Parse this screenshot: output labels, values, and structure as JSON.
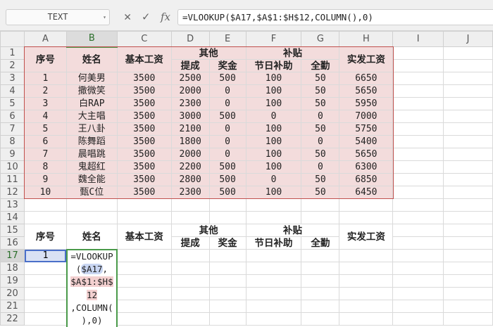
{
  "toolbar": {
    "name_box": "TEXT",
    "cancel_icon": "✕",
    "confirm_icon": "✓",
    "fx_label": "fx",
    "formula": "=VLOOKUP($A17,$A$1:$H$12,COLUMN(),0)"
  },
  "columns": [
    "A",
    "B",
    "C",
    "D",
    "E",
    "F",
    "G",
    "H",
    "I",
    "J"
  ],
  "header": {
    "seq": "序号",
    "name": "姓名",
    "base": "基本工资",
    "other": "其他",
    "commission": "提成",
    "bonus": "奖金",
    "subsidy": "补贴",
    "holiday": "节日补助",
    "attendance": "全勤",
    "net": "实发工资"
  },
  "rows": [
    [
      "1",
      "何美男",
      "3500",
      "2500",
      "500",
      "100",
      "50",
      "6650"
    ],
    [
      "2",
      "撒微笑",
      "3500",
      "2000",
      "0",
      "100",
      "50",
      "5650"
    ],
    [
      "3",
      "白RAP",
      "3500",
      "2300",
      "0",
      "100",
      "50",
      "5950"
    ],
    [
      "4",
      "大主唱",
      "3500",
      "3000",
      "500",
      "0",
      "0",
      "7000"
    ],
    [
      "5",
      "王八卦",
      "3500",
      "2100",
      "0",
      "100",
      "50",
      "5750"
    ],
    [
      "6",
      "陈舞蹈",
      "3500",
      "1800",
      "0",
      "100",
      "0",
      "5400"
    ],
    [
      "7",
      "晨唱跳",
      "3500",
      "2000",
      "0",
      "100",
      "50",
      "5650"
    ],
    [
      "8",
      "鬼超红",
      "3500",
      "2200",
      "500",
      "100",
      "0",
      "6300"
    ],
    [
      "9",
      "魏全能",
      "3500",
      "2800",
      "500",
      "0",
      "50",
      "6850"
    ],
    [
      "10",
      "甄C位",
      "3500",
      "2300",
      "500",
      "100",
      "50",
      "6450"
    ]
  ],
  "lookup": {
    "a17": "1",
    "edit_lines": [
      "=VLOOKUP",
      "(",
      ",",
      "",
      ",COLUMN(",
      "),0)"
    ],
    "ref1": "$A17",
    "ref2a": "$A$1:$H$",
    "ref2b": "12"
  }
}
